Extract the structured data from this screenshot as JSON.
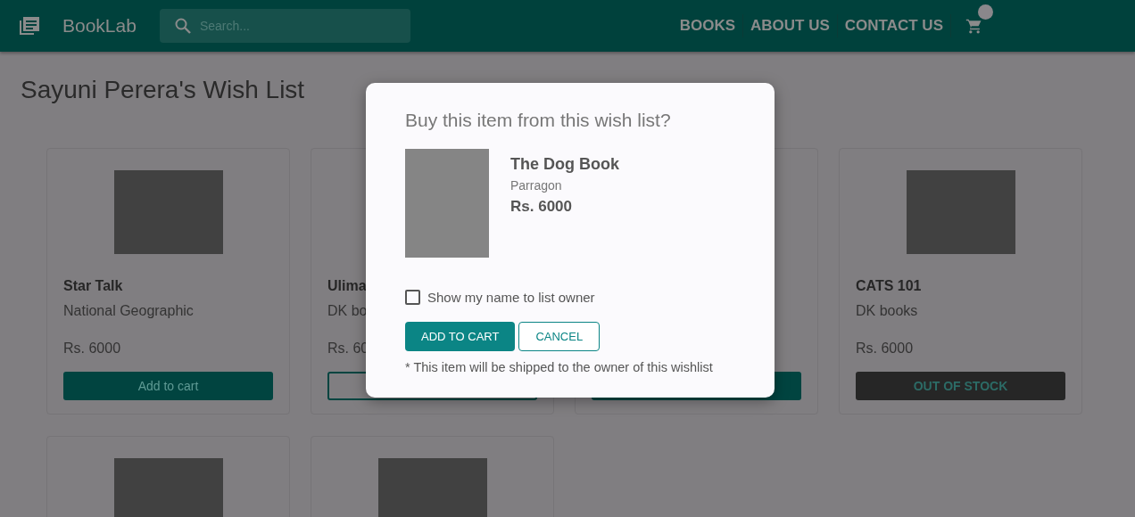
{
  "brand": "BookLab",
  "search": {
    "placeholder": "Search..."
  },
  "nav": [
    "BOOKS",
    "ABOUT US",
    "CONTACT US"
  ],
  "title": "Sayuni Perera's Wish List",
  "cards": [
    {
      "kind": "full",
      "cover": true,
      "title": "Star Talk",
      "publisher": "National Geographic",
      "price": "Rs. 6000",
      "button": {
        "kind": "filled",
        "label": "Add to cart"
      }
    },
    {
      "kind": "full",
      "cover": false,
      "title": "Ulima",
      "publisher": "DK bo",
      "price": "Rs. 60",
      "button": {
        "kind": "outline"
      }
    },
    {
      "kind": "full",
      "cover": false,
      "button": {
        "kind": "filled"
      }
    },
    {
      "kind": "full",
      "cover": true,
      "title": "CATS 101",
      "publisher": "DK books",
      "price": "Rs. 6000",
      "button": {
        "kind": "disabled",
        "label": "OUT OF STOCK"
      }
    },
    {
      "kind": "image_only",
      "cover": true
    },
    {
      "kind": "image_only",
      "cover": true
    }
  ],
  "dialog": {
    "title": "Buy this item from this wish list?",
    "book": {
      "title": "The Dog Book",
      "publisher": "Parragon",
      "price": "Rs. 6000"
    },
    "checkbox": {
      "label": "Show my name to list owner",
      "checked": false
    },
    "buttons": [
      {
        "kind": "primary",
        "label": "ADD TO CART"
      },
      {
        "kind": "outline",
        "label": "CANCEL"
      }
    ],
    "note": "* This item will be shipped to the owner of this wishlist"
  }
}
